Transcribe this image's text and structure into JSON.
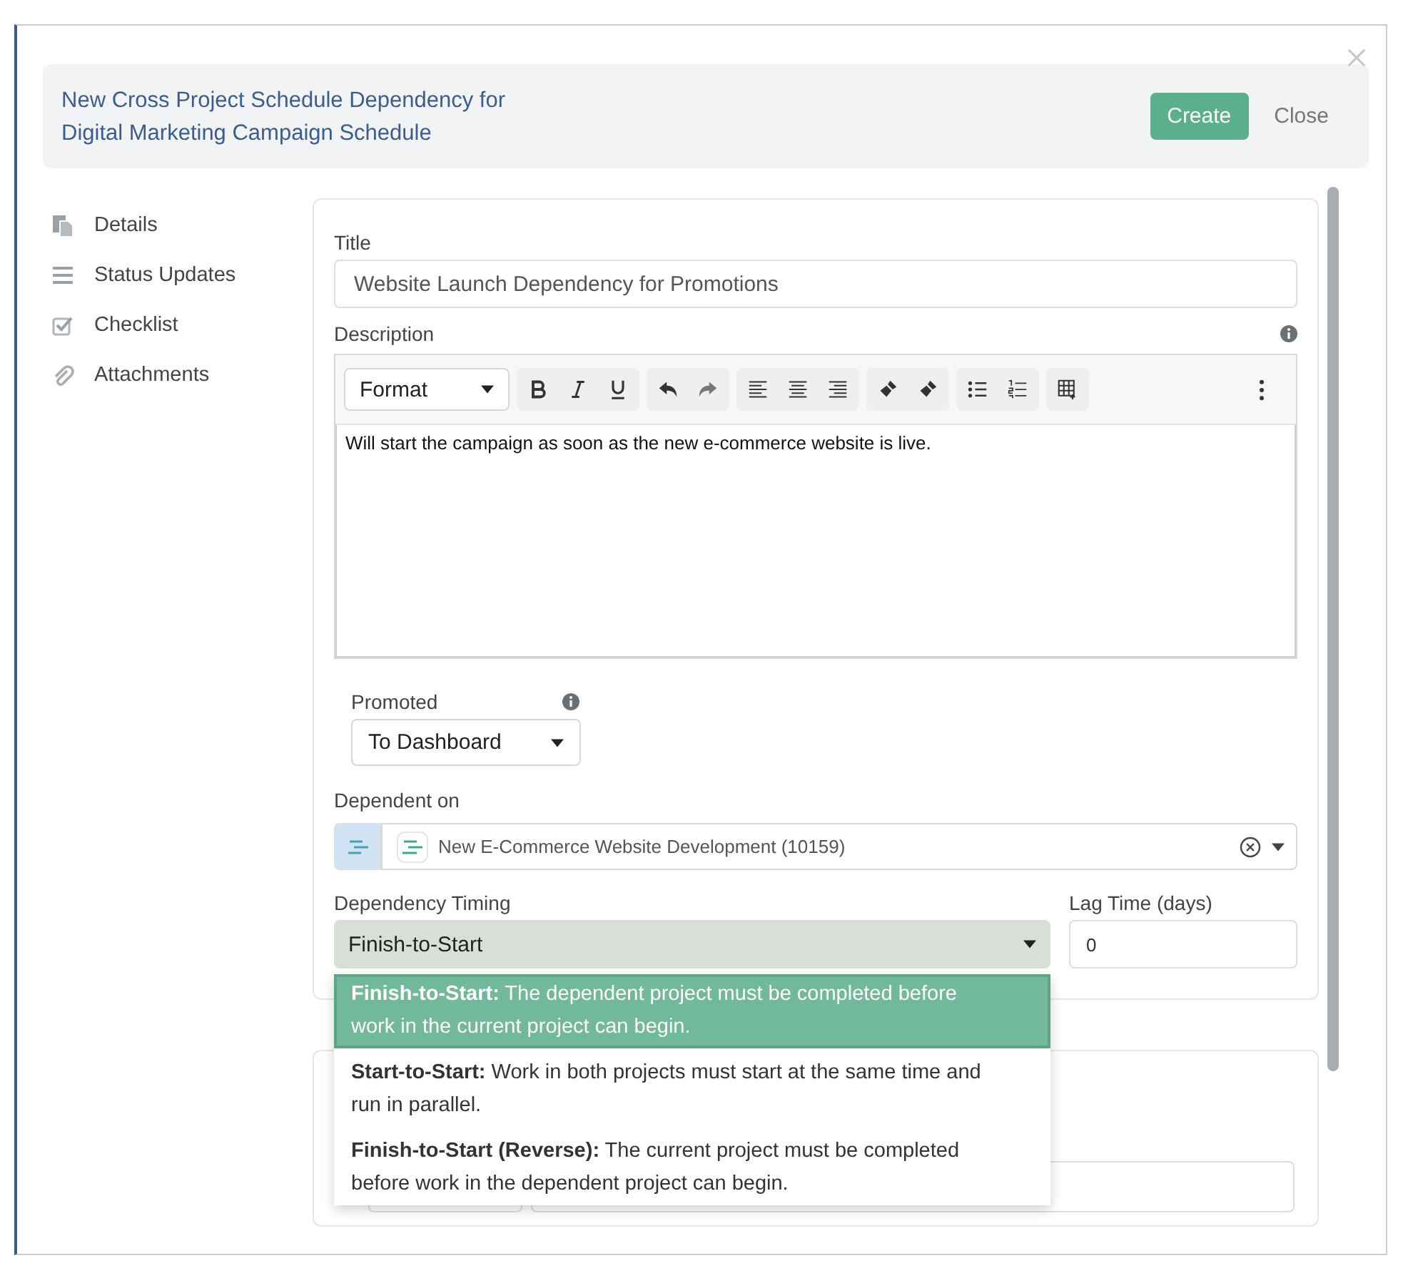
{
  "dialog": {
    "title": "New Cross Project Schedule Dependency for Digital Marketing Campaign Schedule",
    "buttons": [
      {
        "label": "Create",
        "kind": "primary"
      },
      {
        "label": "Close",
        "kind": "link"
      }
    ]
  },
  "sidebar": {
    "items": [
      {
        "label": "Details"
      },
      {
        "label": "Status Updates"
      },
      {
        "label": "Checklist"
      },
      {
        "label": "Attachments"
      }
    ]
  },
  "form": {
    "title_label": "Title",
    "title_value": "Website Launch Dependency for Promotions",
    "description_label": "Description",
    "format_select": "Format",
    "description_text": "Will start the campaign as soon as the new e-commerce website is live.",
    "promoted_label": "Promoted",
    "promoted_value": "To Dashboard",
    "dependent_label": "Dependent on",
    "dependent_value": "New E-Commerce Website Development (10159)",
    "timing_label": "Dependency Timing",
    "timing_value": "Finish-to-Start",
    "lag_label": "Lag Time (days)",
    "lag_value": "0"
  },
  "timing_options": [
    {
      "text": "**Finish-to-Start:** The dependent project must be completed before work in the current project can begin.",
      "selected": true
    },
    {
      "text": "**Start-to-Start:** Work in both projects must start at the same time and run in parallel.",
      "selected": false
    },
    {
      "text": "**Finish-to-Start (Reverse):** The current project must be completed before work in the dependent project can begin.",
      "selected": false
    }
  ]
}
